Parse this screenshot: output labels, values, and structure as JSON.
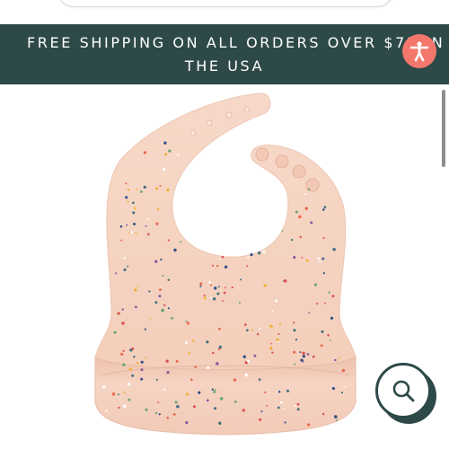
{
  "banner": {
    "line1": "FREE SHIPPING ON ALL ORDERS OVER $75 IN",
    "line2": "THE USA"
  },
  "accessibility_button": {
    "icon": "accessibility-icon",
    "color": "#f3786b"
  },
  "product": {
    "image": "speckled-silicone-bib",
    "color": "#f6d6c6"
  },
  "search_button": {
    "icon": "search-icon"
  },
  "colors": {
    "banner_bg": "#2e4a48",
    "banner_text": "#ffffff",
    "accent": "#f3786b"
  }
}
